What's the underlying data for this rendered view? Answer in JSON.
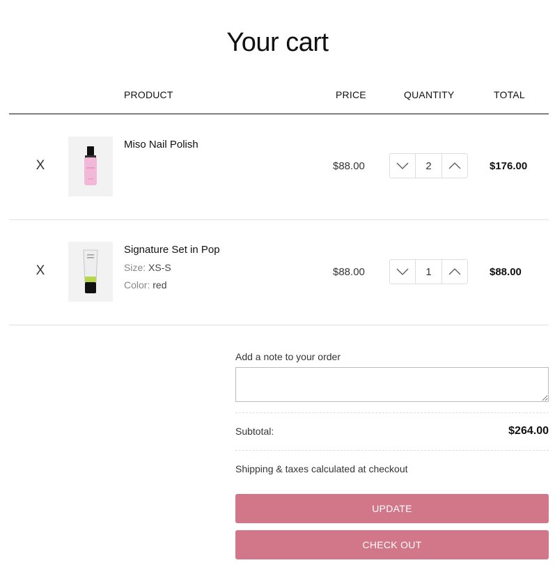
{
  "page": {
    "title": "Your cart"
  },
  "table": {
    "headers": {
      "product": "PRODUCT",
      "price": "PRICE",
      "quantity": "QUANTITY",
      "total": "TOTAL"
    }
  },
  "items": [
    {
      "remove_label": "X",
      "name": "Miso Nail Polish",
      "price": "$88.00",
      "quantity": "2",
      "total": "$176.00",
      "image_icon": "pink-nail-polish-bottle",
      "colors": {
        "body": "#f2b8d8",
        "cap": "#111111"
      }
    },
    {
      "remove_label": "X",
      "name": "Signature Set in Pop",
      "size_label": "Size:",
      "size_value": "XS-S",
      "color_label": "Color:",
      "color_value": "red",
      "price": "$88.00",
      "quantity": "1",
      "total": "$88.00",
      "image_icon": "tube-product",
      "colors": {
        "body": "#eeeeee",
        "accent": "#b8d64a",
        "cap": "#111111"
      }
    }
  ],
  "note": {
    "label": "Add a note to your order",
    "value": ""
  },
  "summary": {
    "subtotal_label": "Subtotal:",
    "subtotal_value": "$264.00",
    "shipping_text": "Shipping & taxes calculated at checkout"
  },
  "buttons": {
    "update": "UPDATE",
    "checkout": "CHECK OUT"
  },
  "theme": {
    "button_color": "#d27689"
  }
}
